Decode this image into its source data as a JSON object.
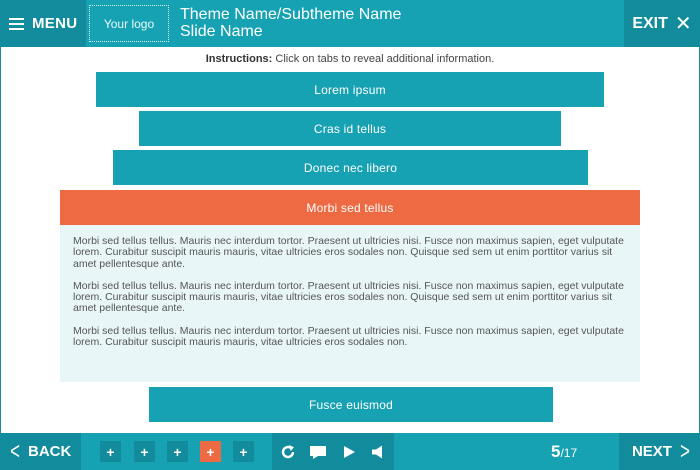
{
  "header": {
    "menu_label": "MENU",
    "logo_text": "Your logo",
    "title": "Theme Name/Subtheme Name",
    "subtitle": "Slide Name",
    "exit_label": "EXIT",
    "exit_icon": "close-icon"
  },
  "instructions": {
    "label": "Instructions:",
    "text": " Click on tabs to reveal additional information."
  },
  "tabs": [
    {
      "label": "Lorem ipsum",
      "active": false
    },
    {
      "label": "Cras id tellus",
      "active": false
    },
    {
      "label": "Donec nec libero",
      "active": false
    },
    {
      "label": "Morbi sed tellus",
      "active": true
    },
    {
      "label": "Fusce euismod",
      "active": false
    }
  ],
  "panel": {
    "paragraphs": [
      "Morbi sed tellus tellus. Mauris nec interdum tortor. Praesent ut ultricies nisi. Fusce non maximus sapien, eget vulputate lorem. Curabitur suscipit mauris mauris, vitae ultricies eros sodales non. Quisque sed sem ut enim porttitor varius sit amet pellentesque ante.",
      "Morbi sed tellus tellus. Mauris nec interdum tortor. Praesent ut ultricies nisi. Fusce non maximus sapien, eget vulputate lorem. Curabitur suscipit mauris mauris, vitae ultricies eros sodales non. Quisque sed sem ut enim porttitor varius sit amet pellentesque ante.",
      "Morbi sed tellus tellus. Mauris nec interdum tortor. Praesent ut ultricies nisi. Fusce non maximus sapien, eget vulputate lorem. Curabitur suscipit mauris mauris, vitae ultricies eros sodales non."
    ]
  },
  "footer": {
    "back_label": "BACK",
    "next_label": "NEXT",
    "dots": [
      "+",
      "+",
      "+",
      "+",
      "+"
    ],
    "active_dot": 3,
    "controls": [
      "refresh-icon",
      "subtitles-icon",
      "play-icon",
      "volume-icon"
    ],
    "current_page": "5",
    "total_pages": "/17"
  },
  "colors": {
    "teal": "#17a2b3",
    "teal_dark": "#128c9c",
    "accent": "#ee6a43",
    "panel_bg": "#e9f6f8"
  }
}
